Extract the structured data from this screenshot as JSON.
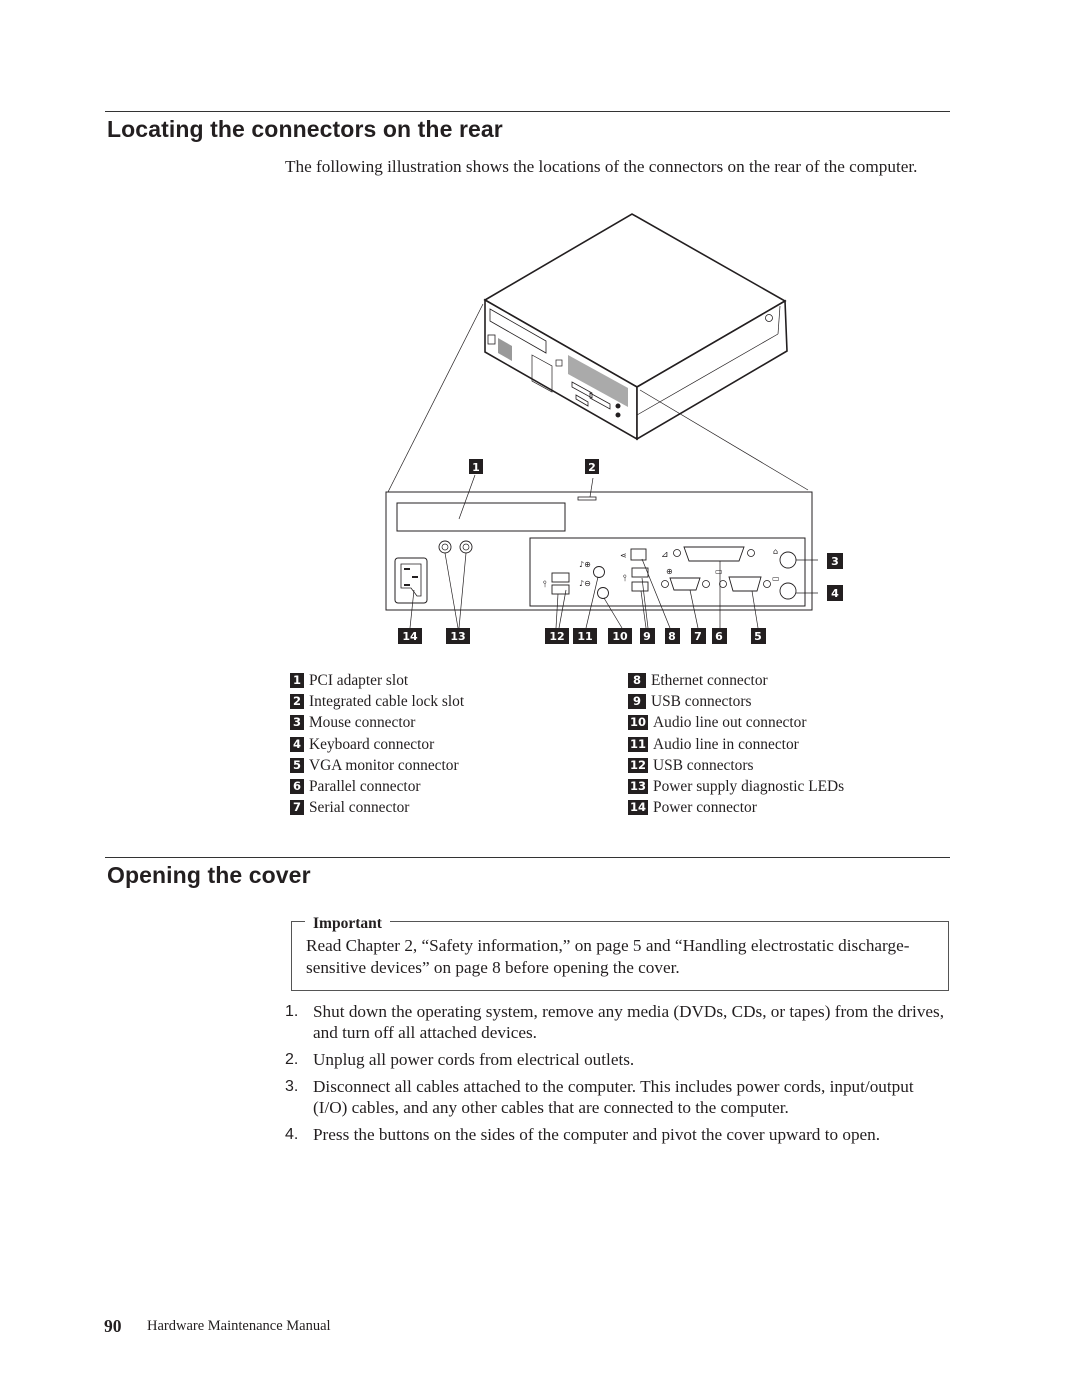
{
  "section1": {
    "title": "Locating the connectors on the rear",
    "intro": "The following illustration shows the locations of the connectors on the rear of the computer."
  },
  "figure": {
    "callouts": [
      "1",
      "2",
      "3",
      "4",
      "5",
      "6",
      "7",
      "8",
      "9",
      "10",
      "11",
      "12",
      "13",
      "14"
    ]
  },
  "legend": {
    "left": [
      {
        "num": "1",
        "label": "PCI adapter slot"
      },
      {
        "num": "2",
        "label": "Integrated cable lock slot"
      },
      {
        "num": "3",
        "label": "Mouse connector"
      },
      {
        "num": "4",
        "label": "Keyboard connector"
      },
      {
        "num": "5",
        "label": "VGA monitor connector"
      },
      {
        "num": "6",
        "label": "Parallel connector"
      },
      {
        "num": "7",
        "label": "Serial connector"
      }
    ],
    "right": [
      {
        "num": "8",
        "label": "Ethernet connector"
      },
      {
        "num": "9",
        "label": "USB connectors"
      },
      {
        "num": "10",
        "label": "Audio line out connector"
      },
      {
        "num": "11",
        "label": "Audio line in connector"
      },
      {
        "num": "12",
        "label": "USB connectors"
      },
      {
        "num": "13",
        "label": "Power supply diagnostic LEDs"
      },
      {
        "num": "14",
        "label": "Power connector"
      }
    ]
  },
  "section2": {
    "title": "Opening the cover",
    "important_label": "Important",
    "important_text": "Read Chapter 2, “Safety information,” on page 5 and “Handling electrostatic discharge-sensitive devices” on page 8 before opening the cover.",
    "steps": [
      {
        "num": "1.",
        "text": "Shut down the operating system, remove any media (DVDs, CDs, or tapes) from the drives, and turn off all attached devices."
      },
      {
        "num": "2.",
        "text": "Unplug all power cords from electrical outlets."
      },
      {
        "num": "3.",
        "text": "Disconnect all cables attached to the computer. This includes power cords, input/output (I/O) cables, and any other cables that are connected to the computer."
      },
      {
        "num": "4.",
        "text": "Press the buttons on the sides of the computer and pivot the cover upward to open."
      }
    ]
  },
  "footer": {
    "page_number": "90",
    "manual_title": "Hardware Maintenance Manual"
  }
}
